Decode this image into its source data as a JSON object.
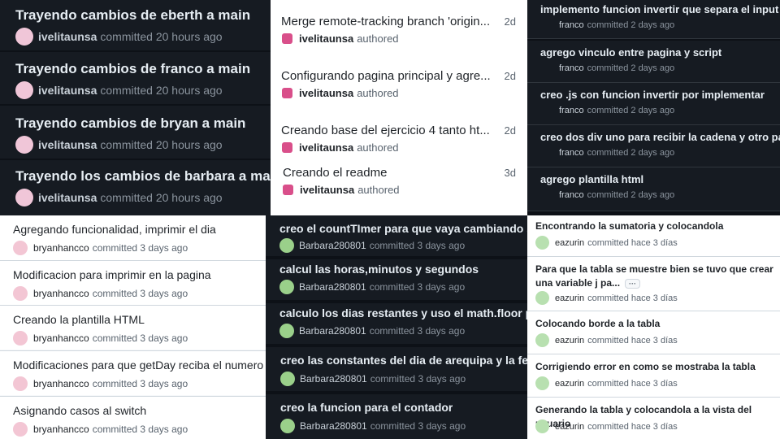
{
  "panel_a": {
    "commits": [
      {
        "message": "Trayendo cambios de eberth a main",
        "author": "ivelitaunsa",
        "verb": "committed",
        "time": "20 hours ago"
      },
      {
        "message": "Trayendo cambios de franco a main",
        "author": "ivelitaunsa",
        "verb": "committed",
        "time": "20 hours ago"
      },
      {
        "message": "Trayendo cambios de bryan a main",
        "author": "ivelitaunsa",
        "verb": "committed",
        "time": "20 hours ago"
      },
      {
        "message": "Trayendo los cambios de barbara a main",
        "author": "ivelitaunsa",
        "verb": "committed",
        "time": "20 hours ago"
      }
    ]
  },
  "panel_b": {
    "commits": [
      {
        "message": "Merge remote-tracking branch 'origin...",
        "author": "ivelitaunsa",
        "verb": "authored",
        "time": "2d"
      },
      {
        "message": "Configurando pagina principal y agre...",
        "author": "ivelitaunsa",
        "verb": "authored",
        "time": "2d"
      },
      {
        "message": "Creando base del ejercicio 4 tanto ht...",
        "author": "ivelitaunsa",
        "verb": "authored",
        "time": "2d"
      },
      {
        "message": "Creando el readme",
        "author": "ivelitaunsa",
        "verb": "authored",
        "time": "3d"
      }
    ]
  },
  "panel_c": {
    "commits": [
      {
        "message": "implemento funcion invertir que separa el input en",
        "author": "franco",
        "verb": "committed",
        "time": "2 days ago"
      },
      {
        "message": "agrego vinculo entre pagina y script",
        "author": "franco",
        "verb": "committed",
        "time": "2 days ago"
      },
      {
        "message": "creo .js con funcion invertir por implementar",
        "author": "franco",
        "verb": "committed",
        "time": "2 days ago"
      },
      {
        "message": "creo dos div uno para recibir la cadena y otro para",
        "author": "franco",
        "verb": "committed",
        "time": "2 days ago"
      },
      {
        "message": "agrego plantilla html",
        "author": "franco",
        "verb": "committed",
        "time": "2 days ago"
      }
    ]
  },
  "panel_d": {
    "commits": [
      {
        "message": "Agregando funcionalidad, imprimir el dia",
        "author": "bryanhancco",
        "verb": "committed",
        "time": "3 days ago"
      },
      {
        "message": "Modificacion para imprimir en la pagina",
        "author": "bryanhancco",
        "verb": "committed",
        "time": "3 days ago"
      },
      {
        "message": "Creando la plantilla HTML",
        "author": "bryanhancco",
        "verb": "committed",
        "time": "3 days ago"
      },
      {
        "message": "Modificaciones para que getDay reciba el numero d",
        "author": "bryanhancco",
        "verb": "committed",
        "time": "3 days ago"
      },
      {
        "message": "Asignando casos al switch",
        "author": "bryanhancco",
        "verb": "committed",
        "time": "3 days ago"
      }
    ]
  },
  "panel_e": {
    "commits": [
      {
        "message": "creo el countTImer para que vaya cambiando seg",
        "author": "Barbara280801",
        "verb": "committed",
        "time": "3 days ago"
      },
      {
        "message": "calcul las horas,minutos y segundos",
        "author": "Barbara280801",
        "verb": "committed",
        "time": "3 days ago"
      },
      {
        "message": "calculo los dias restantes y uso el math.floor para",
        "author": "Barbara280801",
        "verb": "committed",
        "time": "3 days ago"
      },
      {
        "message": "creo las constantes del dia de arequipa y la fec",
        "author": "Barbara280801",
        "verb": "committed",
        "time": "3 days ago"
      },
      {
        "message": "creo la funcion para el contador",
        "author": "Barbara280801",
        "verb": "committed",
        "time": "3 days ago"
      }
    ]
  },
  "panel_f": {
    "commits": [
      {
        "message": "Encontrando la sumatoria y colocandola",
        "author": "eazurin",
        "verb": "committed",
        "time": "hace 3 días"
      },
      {
        "message": "Para que la tabla se muestre bien se tuvo que crear una variable j pa...",
        "author": "eazurin",
        "verb": "committed",
        "time": "hace 3 días",
        "more": "···"
      },
      {
        "message": "Colocando borde a la tabla",
        "author": "eazurin",
        "verb": "committed",
        "time": "hace 3 días"
      },
      {
        "message": "Corrigiendo error en como se mostraba la tabla",
        "author": "eazurin",
        "verb": "committed",
        "time": "hace 3 días"
      },
      {
        "message": "Generando la tabla y colocandola a la vista del usuario",
        "author": "eazurin",
        "verb": "committed",
        "time": "hace 3 días"
      }
    ]
  },
  "colors": {
    "dark_bg": "#0d1117",
    "dark_row": "#161b22",
    "light_bg": "#ffffff",
    "text_light": "#e6edf3",
    "muted": "#8b949e"
  }
}
